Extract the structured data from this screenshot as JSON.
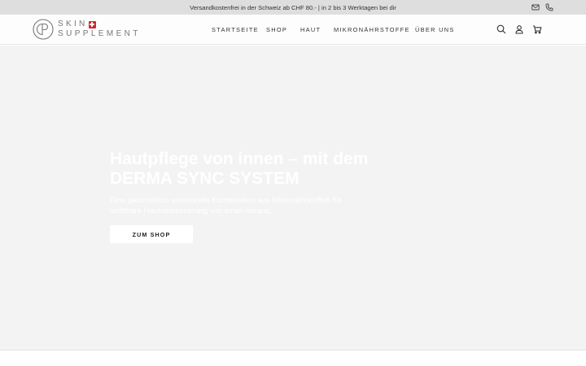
{
  "announcement": {
    "text": "Versandkostenfrei in der Schweiz ab CHF 80.- |  in 2 bis 3 Werktagen bei dir"
  },
  "header": {
    "logo": {
      "line1": "SKIN",
      "line2": "SUPPLEMENT"
    },
    "nav": [
      {
        "label": "STARTSEITE"
      },
      {
        "label": "SHOP"
      },
      {
        "label": "HAUT"
      },
      {
        "label": "MIKRONÄHRSTOFFE"
      },
      {
        "label": "ÜBER UNS"
      }
    ],
    "icons": [
      "search-icon",
      "account-icon",
      "cart-icon"
    ],
    "contact_icons": [
      "mail-icon",
      "phone-icon"
    ]
  },
  "hero": {
    "title": "Hautpflege von innen – mit dem DERMA SYNC SYSTEM",
    "subtitle": "Eine ganzheitlich entwickelte Kombination aus Mikronährstoffen für sichtbare Hautverbesserung von innen heraus.",
    "cta_label": "ZUM SHOP"
  },
  "colors": {
    "accent_red": "#d8232a",
    "hero_bg": "#f3f3f3",
    "announce_bg": "#dedede"
  }
}
